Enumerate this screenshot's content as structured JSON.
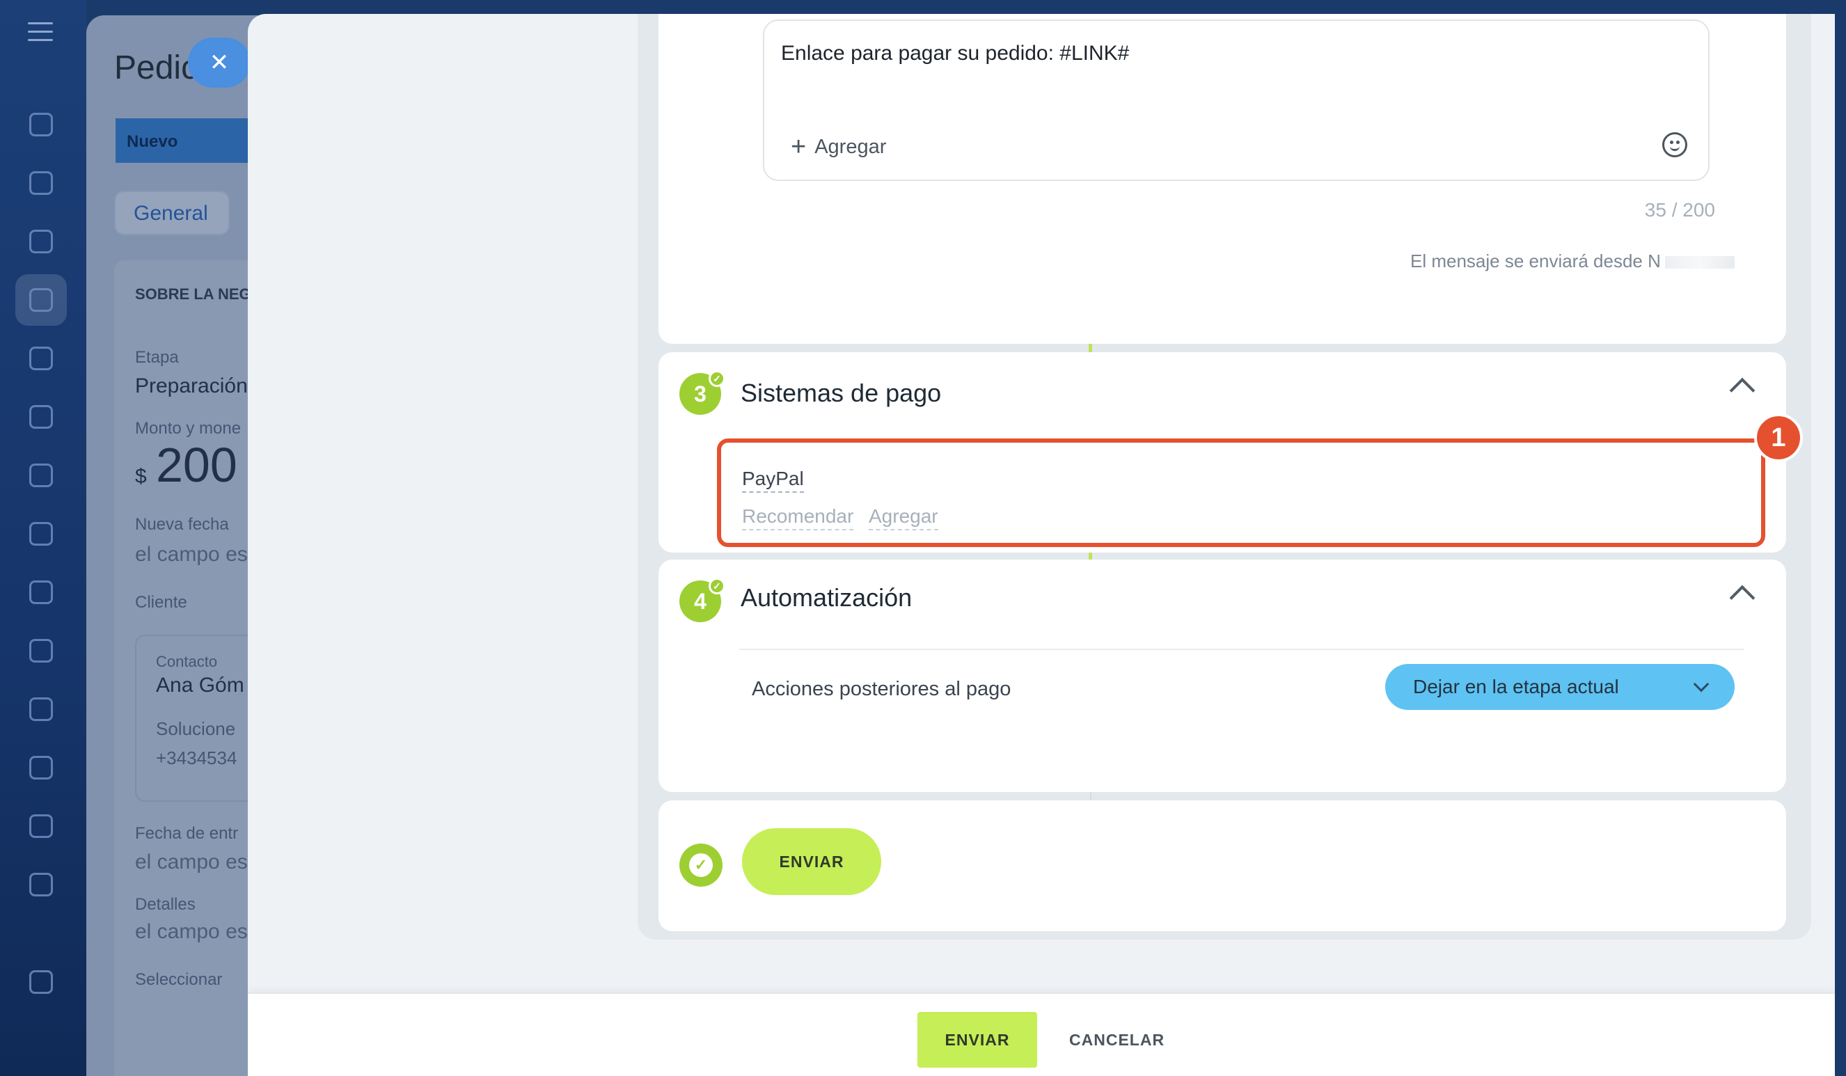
{
  "background_page": {
    "title": "Pedic",
    "stage": "Nuevo",
    "tab_general": "General",
    "section_heading": "SOBRE LA NEG",
    "stage_label": "Etapa",
    "stage_value": "Preparación",
    "amount_label": "Monto y mone",
    "amount_currency": "$",
    "amount_value": "200",
    "new_date_label": "Nueva fecha",
    "new_date_value": "el campo es",
    "client_label": "Cliente",
    "contact_label": "Contacto",
    "contact_name": "Ana Góm",
    "contact_company": "Solucione",
    "contact_phone": "+3434534",
    "delivery_label": "Fecha de entr",
    "delivery_value": "el campo es",
    "details_label": "Detalles",
    "details_value": "el campo es",
    "select_link": "Seleccionar"
  },
  "message": {
    "text": "Enlace para pagar su pedido: #LINK#",
    "add_label": "Agregar",
    "counter": "35 / 200",
    "sender_text": "El mensaje se enviará desde N"
  },
  "payment": {
    "step": "3",
    "title": "Sistemas de pago",
    "system_name": "PayPal",
    "recommend_link": "Recomendar",
    "add_link": "Agregar",
    "badge": "1"
  },
  "automation": {
    "step": "4",
    "title": "Automatización",
    "action_label": "Acciones posteriores al pago",
    "action_value": "Dejar en la etapa actual"
  },
  "send_step": {
    "button": "ENVIAR"
  },
  "footer": {
    "send": "ENVIAR",
    "cancel": "CANCELAR"
  },
  "colors": {
    "accent_green": "#c5ee57",
    "step_green": "#9dcf33",
    "highlight": "#e5512e",
    "select_blue": "#5ec2f2"
  }
}
